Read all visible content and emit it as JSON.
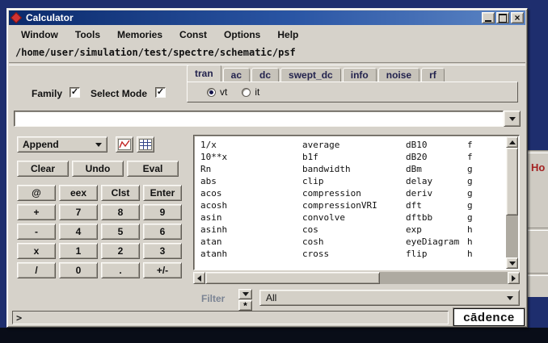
{
  "window": {
    "title": "Calculator"
  },
  "menubar": {
    "items": [
      "Window",
      "Tools",
      "Memories",
      "Const",
      "Options",
      "Help"
    ]
  },
  "path": "/home/user/simulation/test/spectre/schematic/psf",
  "tabs": {
    "items": [
      {
        "label": "tran",
        "selected": true
      },
      {
        "label": "ac",
        "selected": false
      },
      {
        "label": "dc",
        "selected": false
      },
      {
        "label": "swept_dc",
        "selected": false
      },
      {
        "label": "info",
        "selected": false
      },
      {
        "label": "noise",
        "selected": false
      },
      {
        "label": "rf",
        "selected": false
      }
    ]
  },
  "mode": {
    "family_label": "Family",
    "family_checked": true,
    "select_mode_label": "Select Mode",
    "select_mode_checked": true,
    "radios": [
      {
        "label": "vt",
        "selected": true
      },
      {
        "label": "it",
        "selected": false
      }
    ]
  },
  "expression_input": {
    "value": ""
  },
  "left_panel": {
    "append_label": "Append",
    "buttons": [
      "Clear",
      "Undo",
      "Eval"
    ],
    "keypad": [
      [
        "@",
        "eex",
        "Clst",
        "Enter"
      ],
      [
        "+",
        "7",
        "8",
        "9"
      ],
      [
        "-",
        "4",
        "5",
        "6"
      ],
      [
        "x",
        "1",
        "2",
        "3"
      ],
      [
        "/",
        "0",
        ".",
        "+/-"
      ]
    ]
  },
  "function_list": {
    "columns": [
      [
        "1/x",
        "10**x",
        "Rn",
        "abs",
        "acos",
        "acosh",
        "asin",
        "asinh",
        "atan",
        "atanh"
      ],
      [
        "average",
        "b1f",
        "bandwidth",
        "clip",
        "compression",
        "compressionVRI",
        "convolve",
        "cos",
        "cosh",
        "cross"
      ],
      [
        "dB10",
        "dB20",
        "dBm",
        "delay",
        "deriv",
        "dft",
        "dftbb",
        "exp",
        "eyeDiagram",
        "flip"
      ],
      [
        "f",
        "f",
        "g",
        "g",
        "g",
        "g",
        "g",
        "h",
        "h",
        "h"
      ]
    ]
  },
  "filter": {
    "label": "Filter",
    "value": "All"
  },
  "status": {
    "prompt": ">"
  },
  "logo": {
    "text": "cādence"
  },
  "background_window": {
    "label": "Ho"
  },
  "icons": {
    "close": "×",
    "check": "✓",
    "asterisk": "*"
  }
}
